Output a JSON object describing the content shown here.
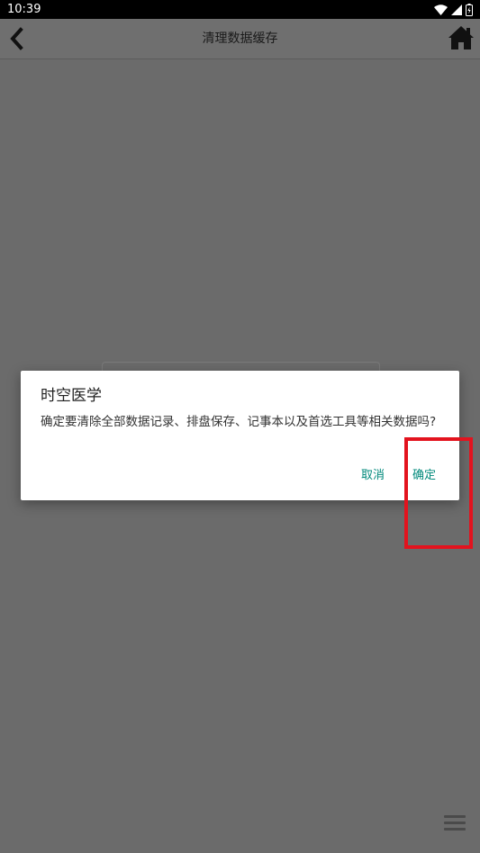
{
  "status_bar": {
    "time": "10:39",
    "icons": [
      "wifi-icon",
      "cellular-signal-icon",
      "battery-icon"
    ]
  },
  "app_bar": {
    "title": "清理数据缓存",
    "back_icon": "chevron-left-icon",
    "home_icon": "home-icon"
  },
  "dialog": {
    "title": "时空医学",
    "message": "确定要清除全部数据记录、排盘保存、记事本以及首选工具等相关数据吗?",
    "cancel_label": "取消",
    "confirm_label": "确定"
  },
  "colors": {
    "accent": "#00897b",
    "overlay": "#6b6b6b",
    "highlight": "#e3131e"
  }
}
